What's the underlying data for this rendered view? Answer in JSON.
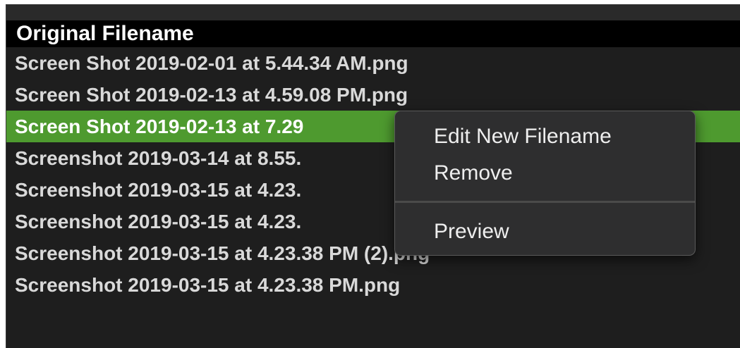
{
  "table": {
    "header": "Original Filename",
    "rows": [
      "Screen Shot 2019-02-01 at 5.44.34 AM.png",
      "Screen Shot 2019-02-13 at 4.59.08 PM.png",
      "Screen Shot 2019-02-13 at 7.29",
      "Screenshot 2019-03-14 at 8.55.",
      "Screenshot 2019-03-15 at 4.23.",
      "Screenshot 2019-03-15 at 4.23.",
      "Screenshot 2019-03-15 at 4.23.38 PM (2).png",
      "Screenshot 2019-03-15 at 4.23.38 PM.png"
    ],
    "selected_index": 2
  },
  "context_menu": {
    "items": [
      "Edit New Filename",
      "Remove"
    ],
    "secondary_items": [
      "Preview"
    ]
  },
  "colors": {
    "selection": "#4e9a2f",
    "background": "#1e1e1e",
    "header_background": "#000000",
    "menu_background": "#2e2e2f"
  }
}
